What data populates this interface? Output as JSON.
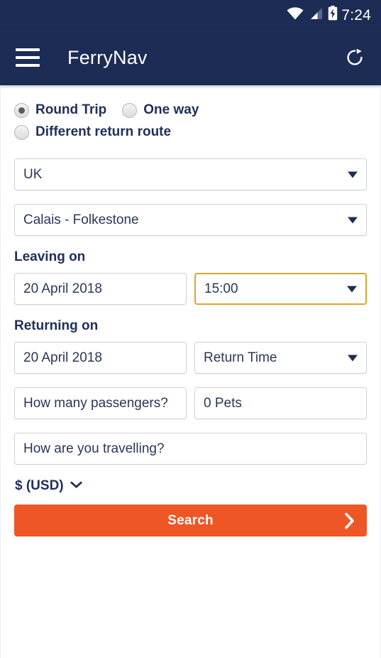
{
  "status_bar": {
    "time": "7:24",
    "icons": [
      "wifi-icon",
      "cell-signal-icon",
      "battery-charging-icon"
    ]
  },
  "app_bar": {
    "menu_icon": "hamburger-menu-icon",
    "title": "FerryNav",
    "refresh_icon": "refresh-icon"
  },
  "colors": {
    "header_navy": "#1c2c54",
    "accent_orange": "#ee5626",
    "focus_gold": "#dda52a",
    "text_navy": "#20305a",
    "field_border": "#cfd2d6"
  },
  "trip_type": {
    "options": [
      {
        "label": "Round Trip",
        "selected": true
      },
      {
        "label": "One way",
        "selected": false
      },
      {
        "label": "Different return route",
        "selected": false
      }
    ]
  },
  "form": {
    "country": {
      "value": "UK",
      "caret_icon": "chevron-down-icon"
    },
    "route": {
      "value": "Calais - Folkestone",
      "caret_icon": "chevron-down-icon"
    },
    "leaving_label": "Leaving on",
    "leaving_date": "20 April 2018",
    "leaving_time": "15:00",
    "returning_label": "Returning on",
    "returning_date": "20 April 2018",
    "returning_time": "Return Time",
    "passengers": "How many passengers?",
    "pets": "0 Pets",
    "travelling": "How are you travelling?"
  },
  "currency": {
    "value": "$ (USD)",
    "caret_icon": "chevron-down-icon"
  },
  "search": {
    "label": "Search",
    "arrow_icon": "chevron-right-icon"
  }
}
